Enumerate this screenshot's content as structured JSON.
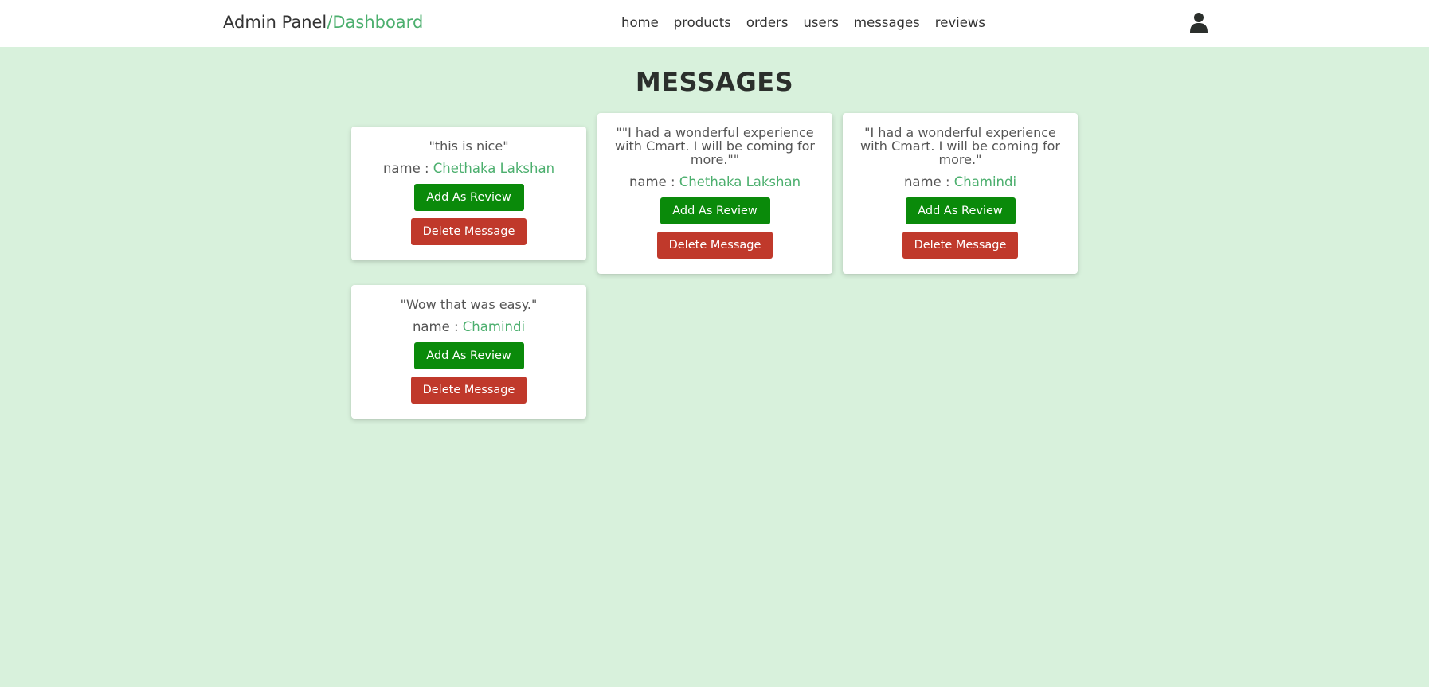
{
  "header": {
    "brand_main": "Admin Panel",
    "brand_accent": "/Dashboard",
    "nav": [
      "home",
      "products",
      "orders",
      "users",
      "messages",
      "reviews"
    ],
    "user_icon": "user-icon"
  },
  "page_title": "MESSAGES",
  "name_prefix": "name : ",
  "buttons": {
    "add_review": "Add As Review",
    "delete": "Delete Message"
  },
  "messages": [
    {
      "text": "\"this is nice\"",
      "name": "Chethaka Lakshan"
    },
    {
      "text": "\"\"I had a wonderful experience with Cmart. I will be coming for more.\"\"",
      "name": "Chethaka Lakshan"
    },
    {
      "text": "\"I had a wonderful experience with Cmart. I will be coming for more.\"",
      "name": "Chamindi"
    },
    {
      "text": "\"Wow that was easy.\"",
      "name": "Chamindi"
    }
  ],
  "colors": {
    "background": "#d8f1dc",
    "accent": "#4caf6e",
    "review_button": "#0a8a0a",
    "delete_button": "#c0392b"
  }
}
